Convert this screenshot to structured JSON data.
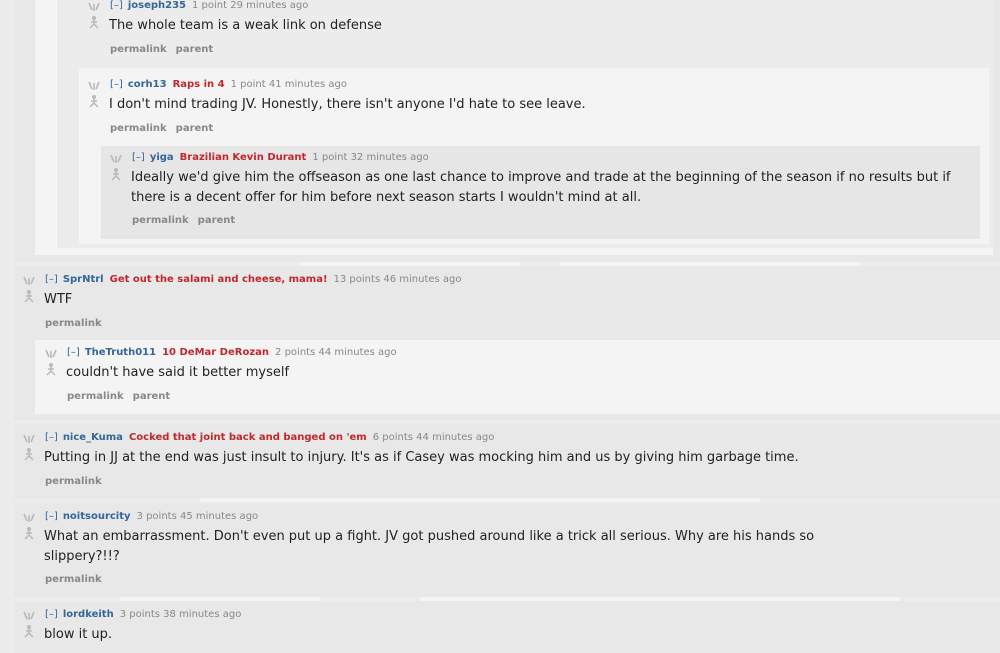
{
  "ui": {
    "toggle": "[–]",
    "permalink": "permalink",
    "parent": "parent"
  },
  "comments": [
    {
      "author": "joseph235",
      "flair": "",
      "score": "1 point",
      "time": "29 minutes ago",
      "body": "The whole team is a weak link on defense"
    },
    {
      "author": "corh13",
      "flair": "Raps in 4",
      "score": "1 point",
      "time": "41 minutes ago",
      "body": "I don't mind trading JV. Honestly, there isn't anyone I'd hate to see leave."
    },
    {
      "author": "yiga",
      "flair": "Brazilian Kevin Durant",
      "score": "1 point",
      "time": "32 minutes ago",
      "body": "Ideally we'd give him the offseason as one last chance to improve and trade at the beginning of the season if no results but if there is a decent offer for him before next season starts I wouldn't mind at all."
    },
    {
      "author": "SprNtrl",
      "flair": "Get out the salami and cheese, mama!",
      "score": "13 points",
      "time": "46 minutes ago",
      "body": "WTF"
    },
    {
      "author": "TheTruth011",
      "flair": "10 DeMar DeRozan",
      "score": "2 points",
      "time": "44 minutes ago",
      "body": "couldn't have said it better myself"
    },
    {
      "author": "nice_Kuma",
      "flair": "Cocked that joint back and banged on 'em",
      "score": "6 points",
      "time": "44 minutes ago",
      "body": "Putting in JJ at the end was just insult to injury. It's as if Casey was mocking him and us by giving him garbage time."
    },
    {
      "author": "noitsourcity",
      "flair": "",
      "score": "3 points",
      "time": "45 minutes ago",
      "body": "What an embarrassment. Don't even put up a fight. JV got pushed around like a trick all serious. Why are his hands so slippery?!!?"
    },
    {
      "author": "lordkeith",
      "flair": "",
      "score": "3 points",
      "time": "38 minutes ago",
      "body": "blow it up."
    }
  ]
}
